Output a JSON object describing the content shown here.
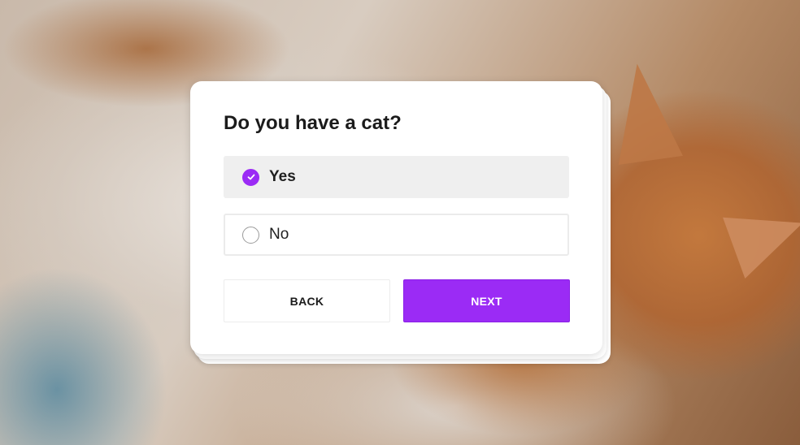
{
  "theme": {
    "accent": "#9b2bf5"
  },
  "quiz": {
    "question": "Do you have a cat?",
    "options": [
      {
        "label": "Yes",
        "selected": true
      },
      {
        "label": "No",
        "selected": false
      }
    ],
    "back_label": "BACK",
    "next_label": "NEXT"
  },
  "icons": {
    "check": "check-icon"
  }
}
